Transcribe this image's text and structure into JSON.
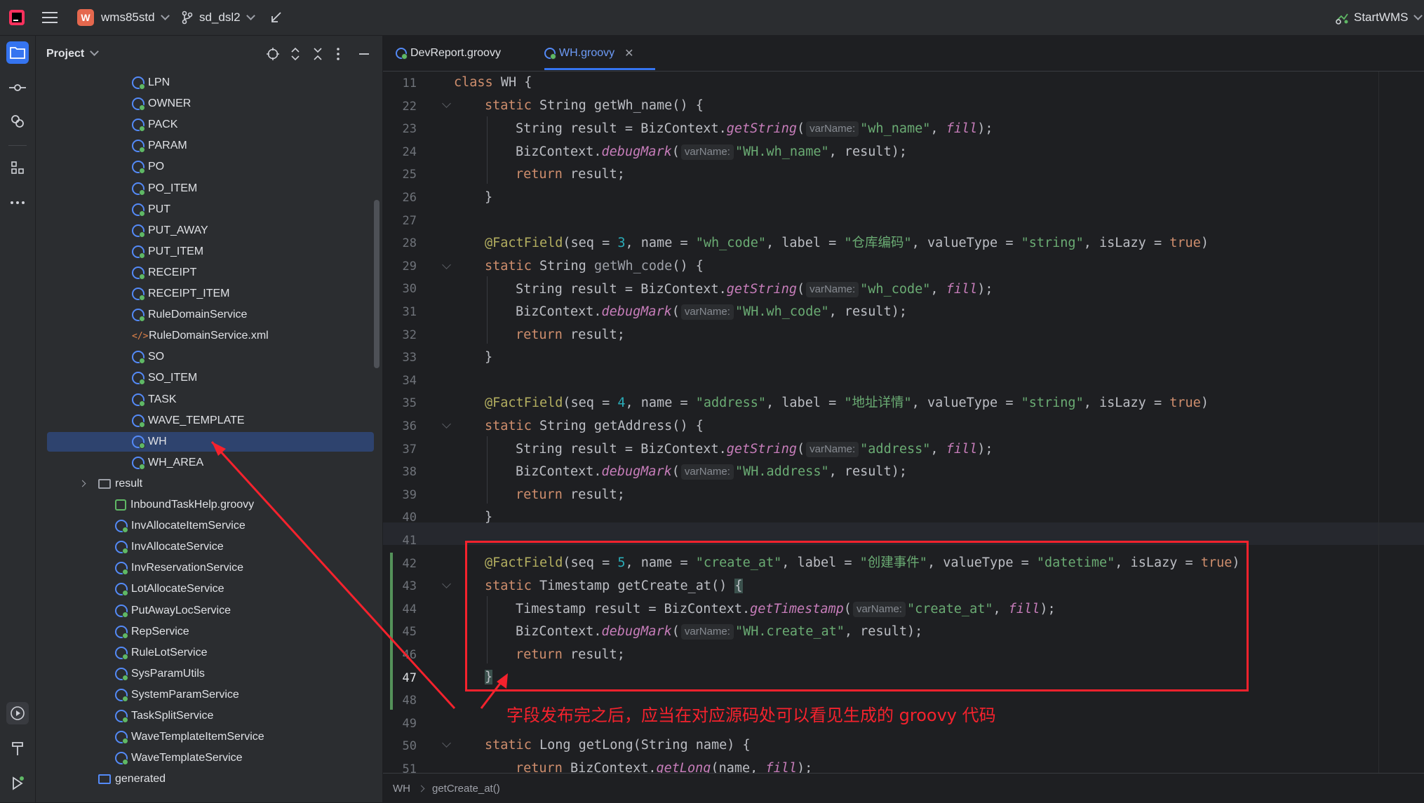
{
  "titlebar": {
    "project_badge": "W",
    "project_name": "wms85std",
    "branch": "sd_dsl2",
    "run_config": "StartWMS"
  },
  "project_panel": {
    "title": "Project",
    "tree": [
      {
        "label": "LPN",
        "icon": "class-icon"
      },
      {
        "label": "OWNER",
        "icon": "class-icon"
      },
      {
        "label": "PACK",
        "icon": "class-icon"
      },
      {
        "label": "PARAM",
        "icon": "class-icon"
      },
      {
        "label": "PO",
        "icon": "class-icon"
      },
      {
        "label": "PO_ITEM",
        "icon": "class-icon"
      },
      {
        "label": "PUT",
        "icon": "class-icon"
      },
      {
        "label": "PUT_AWAY",
        "icon": "class-icon"
      },
      {
        "label": "PUT_ITEM",
        "icon": "class-icon"
      },
      {
        "label": "RECEIPT",
        "icon": "class-icon"
      },
      {
        "label": "RECEIPT_ITEM",
        "icon": "class-icon"
      },
      {
        "label": "RuleDomainService",
        "icon": "class-icon"
      },
      {
        "label": "RuleDomainService.xml",
        "icon": "xml-icon"
      },
      {
        "label": "SO",
        "icon": "class-icon"
      },
      {
        "label": "SO_ITEM",
        "icon": "class-icon"
      },
      {
        "label": "TASK",
        "icon": "class-icon"
      },
      {
        "label": "WAVE_TEMPLATE",
        "icon": "class-icon"
      },
      {
        "label": "WH",
        "icon": "class-icon",
        "selected": true
      },
      {
        "label": "WH_AREA",
        "icon": "class-icon"
      },
      {
        "label": "result",
        "icon": "folder-icon"
      },
      {
        "label": "InboundTaskHelp.groovy",
        "icon": "groovy-file-icon"
      },
      {
        "label": "InvAllocateItemService",
        "icon": "class-icon"
      },
      {
        "label": "InvAllocateService",
        "icon": "class-icon"
      },
      {
        "label": "InvReservationService",
        "icon": "class-icon"
      },
      {
        "label": "LotAllocateService",
        "icon": "class-icon"
      },
      {
        "label": "PutAwayLocService",
        "icon": "class-icon"
      },
      {
        "label": "RepService",
        "icon": "class-icon"
      },
      {
        "label": "RuleLotService",
        "icon": "class-icon"
      },
      {
        "label": "SysParamUtils",
        "icon": "class-icon"
      },
      {
        "label": "SystemParamService",
        "icon": "class-icon"
      },
      {
        "label": "TaskSplitService",
        "icon": "class-icon"
      },
      {
        "label": "WaveTemplateItemService",
        "icon": "class-icon"
      },
      {
        "label": "WaveTemplateService",
        "icon": "class-icon"
      },
      {
        "label": "generated",
        "icon": "folder-blue-icon"
      }
    ]
  },
  "tabs": [
    {
      "label": "DevReport.groovy",
      "active": false
    },
    {
      "label": "WH.groovy",
      "active": true
    }
  ],
  "editor": {
    "line_numbers": [
      "11",
      "22",
      "23",
      "24",
      "25",
      "26",
      "27",
      "28",
      "29",
      "30",
      "31",
      "32",
      "33",
      "34",
      "35",
      "36",
      "37",
      "38",
      "39",
      "40",
      "41",
      "42",
      "43",
      "44",
      "45",
      "46",
      "47",
      "48",
      "49",
      "50",
      "51"
    ],
    "current_line": "47"
  },
  "breadcrumb": {
    "class": "WH",
    "method": "getCreate_at()"
  },
  "annotation": {
    "note": "字段发布完之后，应当在对应源码处可以看见生成的 groovy 代码"
  },
  "colors": {
    "accent": "#548af7",
    "selection": "#2e436e",
    "annotation_red": "#f5222d"
  }
}
